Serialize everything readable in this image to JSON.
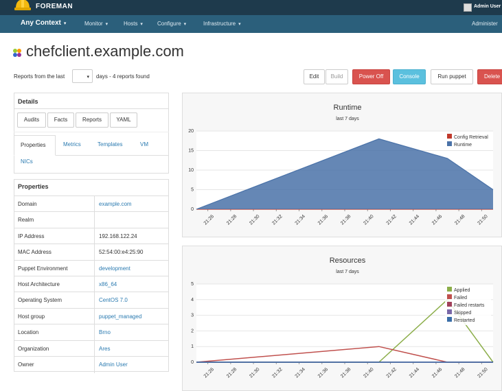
{
  "brand": "FOREMAN",
  "user": {
    "name": "Admin User"
  },
  "nav": {
    "context": "Any Context",
    "items": [
      "Monitor",
      "Hosts",
      "Configure",
      "Infrastructure"
    ],
    "right": "Administer"
  },
  "page": {
    "title": "chefclient.example.com"
  },
  "reports": {
    "prefix": "Reports from the last",
    "days_value": "",
    "suffix": "days - 4 reports found"
  },
  "actions": {
    "edit": "Edit",
    "build": "Build",
    "power_off": "Power Off",
    "console": "Console",
    "run_puppet": "Run puppet",
    "delete": "Delete"
  },
  "details": {
    "heading": "Details",
    "buttons": [
      "Audits",
      "Facts",
      "Reports",
      "YAML"
    ],
    "tabs": [
      "Properties",
      "Metrics",
      "Templates",
      "VM",
      "NICs"
    ],
    "active_tab": "Properties"
  },
  "properties": {
    "heading": "Properties",
    "rows": [
      {
        "key": "Domain",
        "value": "example.com",
        "link": true
      },
      {
        "key": "Realm",
        "value": "",
        "link": false
      },
      {
        "key": "IP Address",
        "value": "192.168.122.24",
        "link": false
      },
      {
        "key": "MAC Address",
        "value": "52:54:00:e4:25:90",
        "link": false
      },
      {
        "key": "Puppet Environment",
        "value": "development",
        "link": true
      },
      {
        "key": "Host Architecture",
        "value": "x86_64",
        "link": true
      },
      {
        "key": "Operating System",
        "value": "CentOS 7.0",
        "link": true
      },
      {
        "key": "Host group",
        "value": "puppet_managed",
        "link": true
      },
      {
        "key": "Location",
        "value": "Brno",
        "link": true
      },
      {
        "key": "Organization",
        "value": "Ares",
        "link": true
      },
      {
        "key": "Owner",
        "value": "Admin User",
        "link": true
      }
    ]
  },
  "colors": {
    "topbar": "#1e3a4c",
    "navbar": "#2b5f7b",
    "runtime": "#4a72a8",
    "config_retrieval": "#c0392b",
    "applied": "#8cae4a",
    "failed": "#c0504d",
    "failed_restarts": "#a0405a",
    "skipped": "#7a68a8",
    "restarted": "#3a6ea8"
  },
  "chart_data": [
    {
      "type": "area",
      "title": "Runtime",
      "subtitle": "last 7 days",
      "x": [
        "21:26",
        "21:28",
        "21:30",
        "21:32",
        "21:34",
        "21:36",
        "21:38",
        "21:40",
        "21:42",
        "21:44",
        "21:46",
        "21:48",
        "21:50"
      ],
      "ylim": [
        0,
        20
      ],
      "yticks": [
        0,
        5,
        10,
        15,
        20
      ],
      "legend_position": "top-right",
      "series": [
        {
          "name": "Config Retrieval",
          "color": "#c0392b",
          "points": [
            [
              "21:25",
              0
            ],
            [
              "21:51",
              0
            ]
          ]
        },
        {
          "name": "Runtime",
          "color": "#4a72a8",
          "points": [
            [
              "21:25",
              0
            ],
            [
              "21:41",
              18
            ],
            [
              "21:47",
              13
            ],
            [
              "21:51",
              5
            ]
          ]
        }
      ]
    },
    {
      "type": "line",
      "title": "Resources",
      "subtitle": "last 7 days",
      "x": [
        "21:26",
        "21:28",
        "21:30",
        "21:32",
        "21:34",
        "21:36",
        "21:38",
        "21:40",
        "21:42",
        "21:44",
        "21:46",
        "21:48",
        "21:50"
      ],
      "ylim": [
        0,
        5
      ],
      "yticks": [
        0,
        1,
        2,
        3,
        4,
        5
      ],
      "legend_position": "top-right",
      "series": [
        {
          "name": "Applied",
          "color": "#8cae4a",
          "points": [
            [
              "21:25",
              0
            ],
            [
              "21:41",
              0
            ],
            [
              "21:47",
              4
            ],
            [
              "21:51",
              0
            ]
          ]
        },
        {
          "name": "Failed",
          "color": "#c0504d",
          "points": [
            [
              "21:25",
              0
            ],
            [
              "21:41",
              1
            ],
            [
              "21:47",
              0
            ],
            [
              "21:51",
              0
            ]
          ]
        },
        {
          "name": "Failed restarts",
          "color": "#a0405a",
          "points": [
            [
              "21:25",
              0
            ],
            [
              "21:51",
              0
            ]
          ]
        },
        {
          "name": "Skipped",
          "color": "#7a68a8",
          "points": [
            [
              "21:25",
              0
            ],
            [
              "21:51",
              0
            ]
          ]
        },
        {
          "name": "Restarted",
          "color": "#3a6ea8",
          "points": [
            [
              "21:25",
              0
            ],
            [
              "21:51",
              0
            ]
          ]
        }
      ]
    }
  ]
}
